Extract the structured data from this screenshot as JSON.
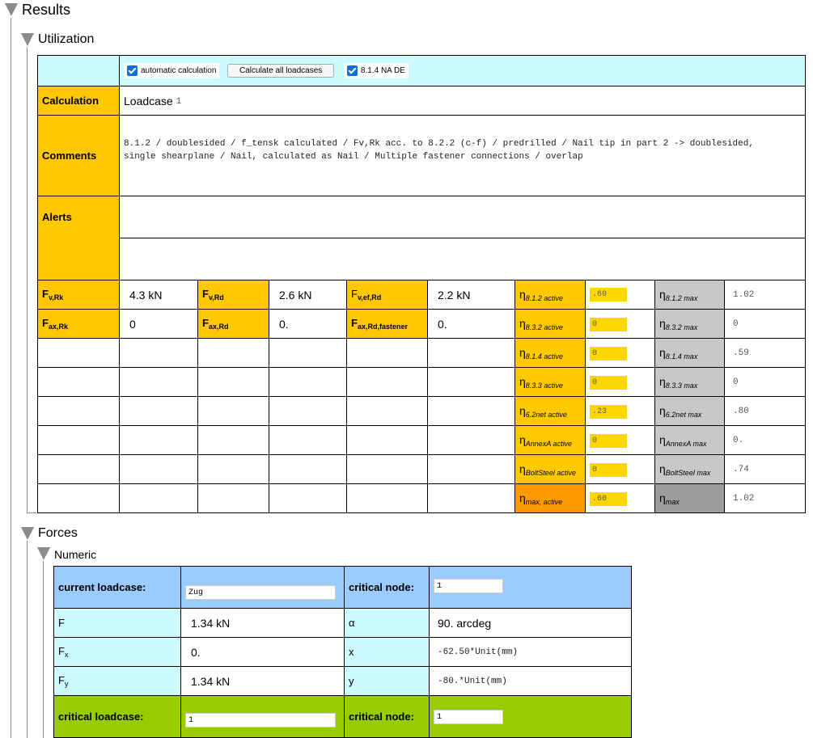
{
  "sections": {
    "results": "Results",
    "utilization": "Utilization",
    "forces": "Forces",
    "numeric": "Numeric"
  },
  "toolbar": {
    "auto_calc_label": "automatic calculation",
    "auto_calc_checked": true,
    "calc_all_button": "Calculate all loadcases",
    "na_de_label": "8.1.4 NA DE",
    "na_de_checked": true
  },
  "utilization": {
    "calculation_label": "Calculation",
    "loadcase_label": "Loadcase",
    "loadcase_value": "1",
    "comments_label": "Comments",
    "comments_line1": "8.1.2 / doublesided / f_tensk calculated / Fv,Rk acc. to 8.2.2 (c-f) / predrilled / Nail tip in part 2 -> doublesided,",
    "comments_line2": "single shearplane / Nail, calculated as Nail / Multiple fastener connections / overlap",
    "alerts_label": "Alerts",
    "fv_rk_value": "4.3 kN",
    "fv_rd_value": "2.6 kN",
    "fv_ef_rd_value": "2.2 kN",
    "fax_rk_value": "0",
    "fax_rd_value": "0.",
    "fax_rd_fastener_value": "0.",
    "etas": [
      {
        "active_sub": "8.1.2 active",
        "active_val": ".60",
        "max_sub": "8.1.2 max",
        "max_val": "1.02"
      },
      {
        "active_sub": "8.3.2 active",
        "active_val": "0",
        "max_sub": "8.3.2 max",
        "max_val": "0"
      },
      {
        "active_sub": "8.1.4 active",
        "active_val": "0",
        "max_sub": "8.1.4 max",
        "max_val": ".59"
      },
      {
        "active_sub": "8.3.3 active",
        "active_val": "0",
        "max_sub": "8.3.3 max",
        "max_val": "0"
      },
      {
        "active_sub": "6.2net active",
        "active_val": ".23",
        "max_sub": "6.2net max",
        "max_val": ".80"
      },
      {
        "active_sub": "AnnexA active",
        "active_val": "0",
        "max_sub": "AnnexA max",
        "max_val": "0."
      },
      {
        "active_sub": "BoltSteel active",
        "active_val": "0",
        "max_sub": "BoltSteel max",
        "max_val": ".74"
      },
      {
        "active_sub": "max, active",
        "active_val": ".60",
        "max_sub": "max",
        "max_val": "1.02"
      }
    ]
  },
  "forces": {
    "current_loadcase_label": "current loadcase:",
    "current_loadcase_value": "Zug",
    "critical_node_label": "critical node:",
    "critical_node_value": "1",
    "f_label": "F",
    "f_value": "1.34 kN",
    "alpha_label": "α",
    "alpha_value": "90. arcdeg",
    "fx_value": "0.",
    "x_label": "x",
    "x_value": "-62.50*Unit(mm)",
    "fy_value": "1.34 kN",
    "y_label": "y",
    "y_value": "-80.*Unit(mm)",
    "critical_loadcase_label": "critical loadcase:",
    "critical_loadcase_value": "1",
    "critical_node2_label": "critical node:",
    "critical_node2_value": "1"
  }
}
